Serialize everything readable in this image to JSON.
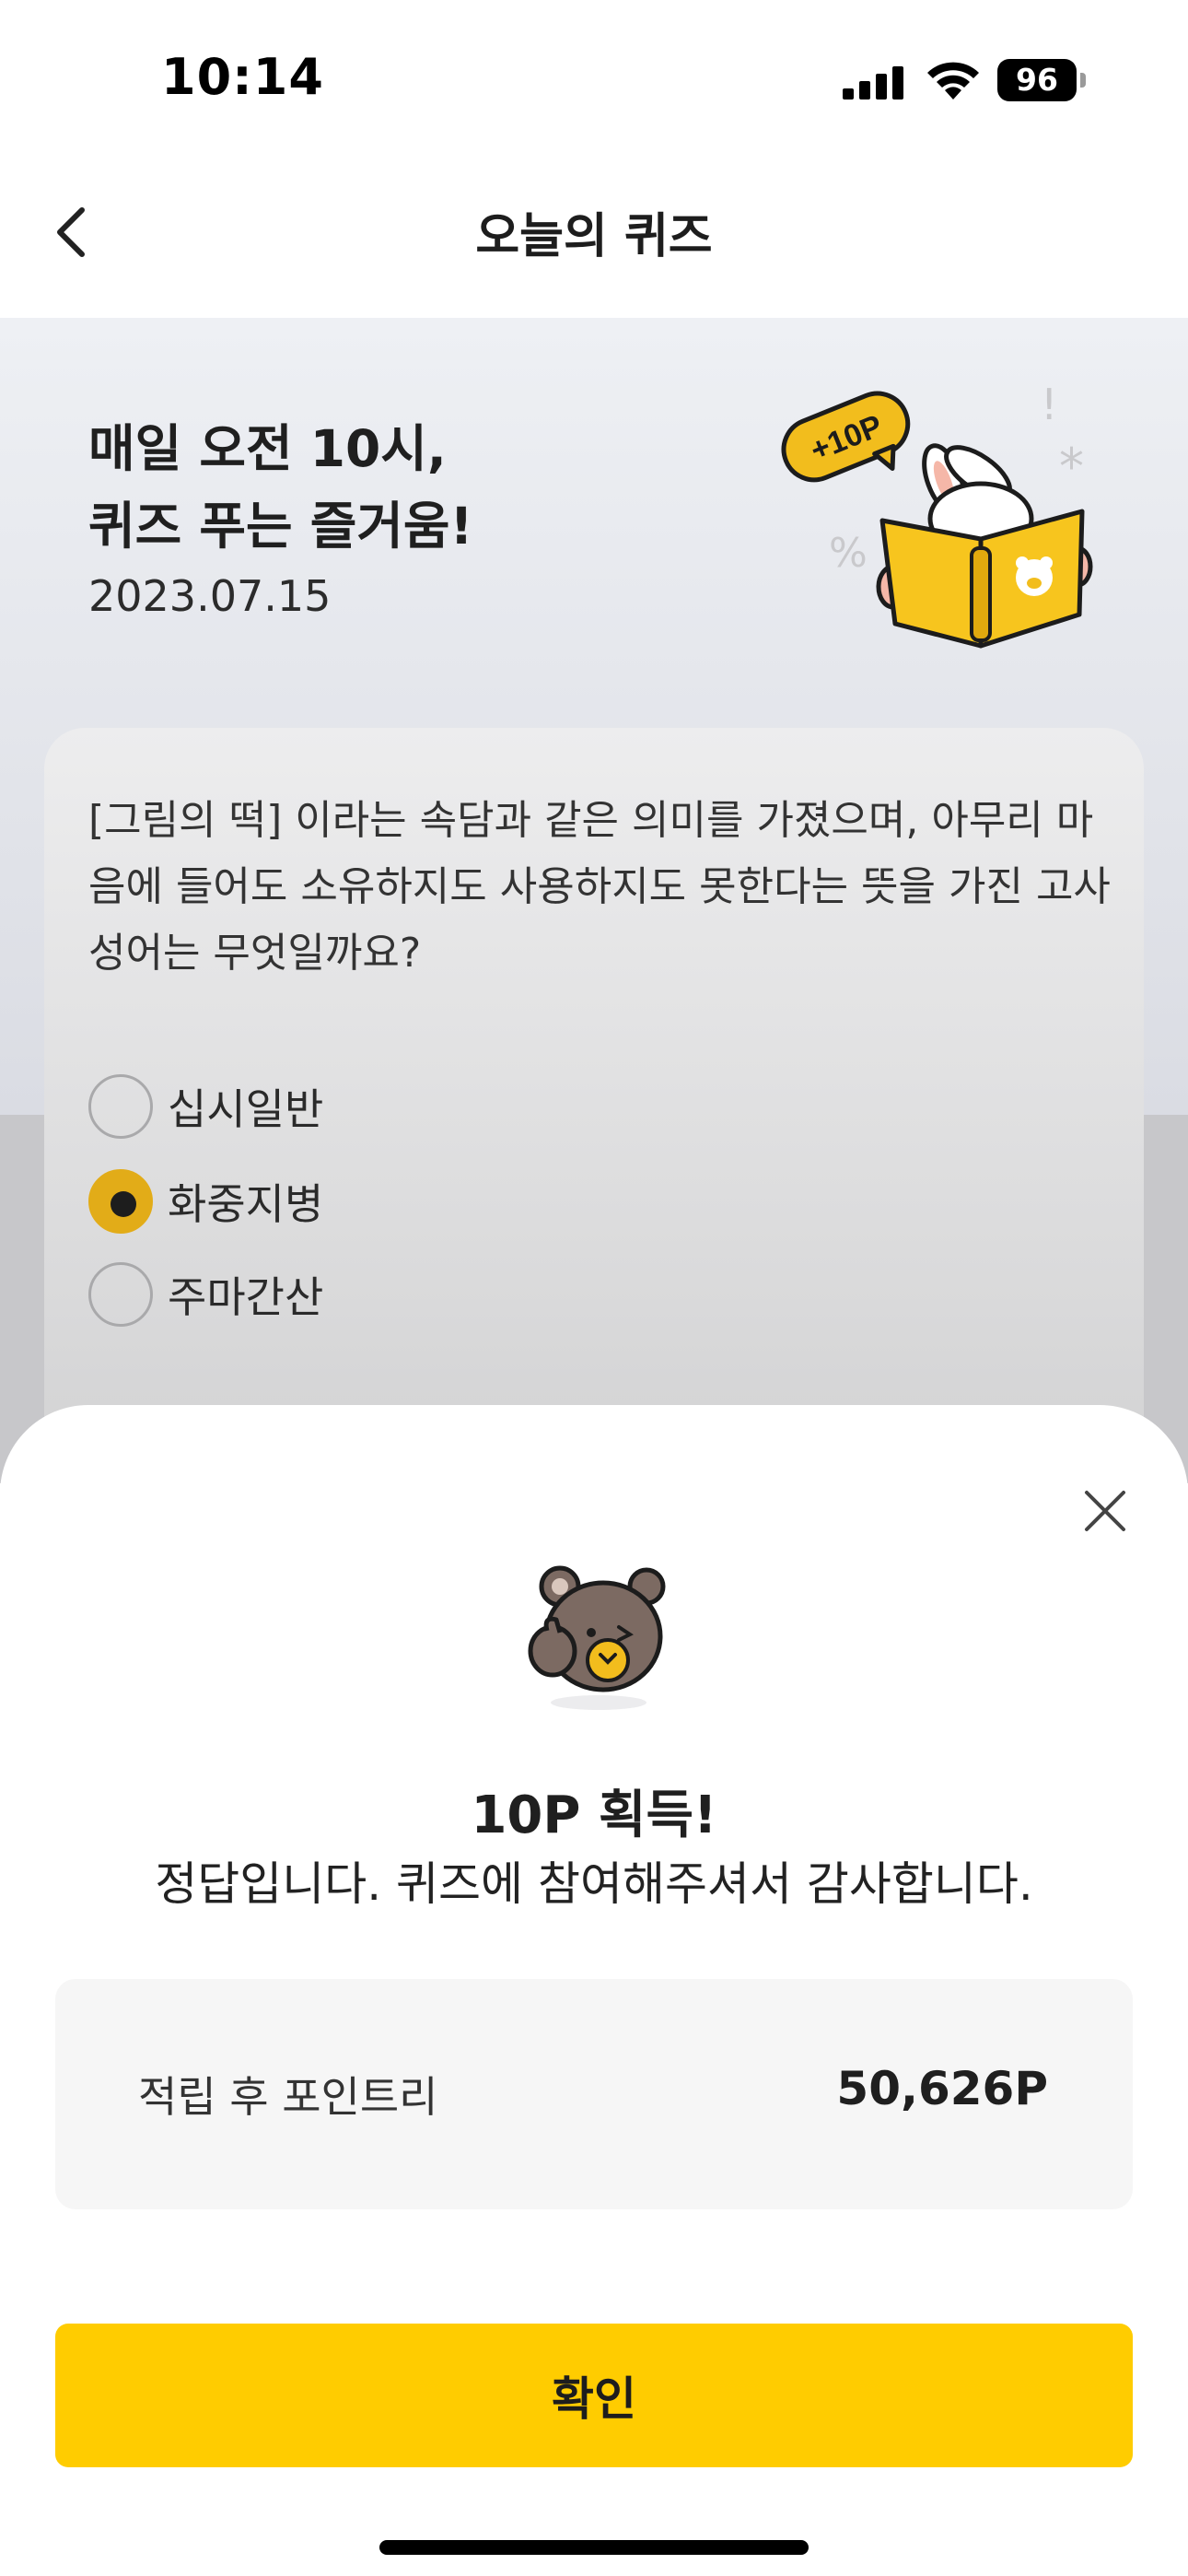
{
  "status_bar": {
    "time": "10:14",
    "battery": "96"
  },
  "nav": {
    "title": "오늘의 퀴즈",
    "back_icon": "chevron-left-icon"
  },
  "hero": {
    "heading_line1": "매일 오전 10시,",
    "heading_line2": "퀴즈 푸는 즐거움!",
    "date": "2023.07.15",
    "badge": "+10P"
  },
  "quiz": {
    "question": "[그림의 떡] 이라는 속담과 같은 의미를 가졌으며, 아무리 마음에 들어도 소유하지도 사용하지도 못한다는 뜻을 가진 고사성어는 무엇일까요?",
    "options": [
      {
        "label": "십시일반",
        "selected": false
      },
      {
        "label": "화중지병",
        "selected": true
      },
      {
        "label": "주마간산",
        "selected": false
      }
    ]
  },
  "result_sheet": {
    "title": "10P 획득!",
    "message": "정답입니다. 퀴즈에 참여해주셔서 감사합니다.",
    "points_label": "적립 후 포인트리",
    "points_value": "50,626P",
    "confirm_label": "확인",
    "close_icon": "close-icon"
  },
  "colors": {
    "accent": "#ffcc00",
    "selected_radio": "#e2ac18",
    "hero_bg": "#eef0f4"
  }
}
